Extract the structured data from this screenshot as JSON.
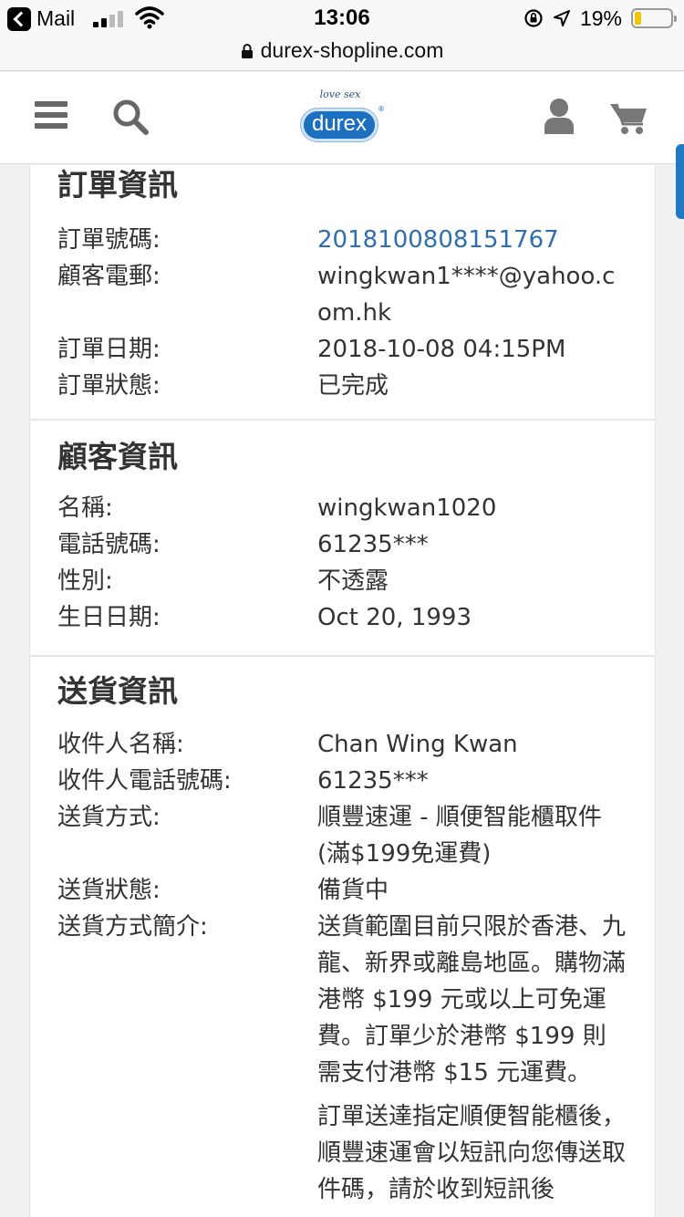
{
  "status_bar": {
    "back_app": "Mail",
    "time": "13:06",
    "battery": "19%",
    "battery_level": 0.19,
    "icons": [
      "back-icon",
      "signal-icon",
      "wifi-icon",
      "rotation-lock-icon",
      "location-icon",
      "battery-icon"
    ]
  },
  "browser": {
    "url": "durex-shopline.com"
  },
  "header": {
    "logo_tagline": "love sex",
    "logo_text": "durex",
    "icons": [
      "menu-icon",
      "search-icon",
      "user-icon",
      "cart-icon"
    ],
    "brand_color": "#1d6fc0"
  },
  "order": {
    "title": "訂單資訊",
    "rows": [
      {
        "label": "訂單號碼:",
        "value": "2018100808151767"
      },
      {
        "label": "顧客電郵:",
        "value": "wingkwan1****@yahoo.com.hk"
      },
      {
        "label": "訂單日期:",
        "value": "2018-10-08 04:15PM"
      },
      {
        "label": "訂單狀態:",
        "value": "已完成"
      }
    ]
  },
  "customer": {
    "title": "顧客資訊",
    "rows": [
      {
        "label": "名稱:",
        "value": "wingkwan1020"
      },
      {
        "label": "電話號碼:",
        "value": "61235***"
      },
      {
        "label": "性別:",
        "value": "不透露"
      },
      {
        "label": "生日日期:",
        "value": "Oct 20, 1993"
      }
    ]
  },
  "delivery": {
    "title": "送貨資訊",
    "rows": [
      {
        "label": "收件人名稱:",
        "value": "Chan Wing Kwan"
      },
      {
        "label": "收件人電話號碼:",
        "value": "61235***"
      },
      {
        "label": "送貨方式:",
        "value": "順豐速運 - 順便智能櫃取件 (滿$199免運費)"
      },
      {
        "label": "送貨狀態:",
        "value": "備貨中"
      },
      {
        "label": "送貨方式簡介:",
        "value": "送貨範圍目前只限於香港、九龍、新界或離島地區。購物滿港幣 $199 元或以上可免運費。訂單少於港幣 $199 則需支付港幣 $15 元運費。"
      }
    ],
    "description_extra": "訂單送達指定順便智能櫃後，順豐速運會以短訊向您傳送取件碼，請於收到短訊後"
  },
  "colors": {
    "link": "#2f6faf",
    "accent": "#1f78c4",
    "battery_low": "#f5c400"
  }
}
